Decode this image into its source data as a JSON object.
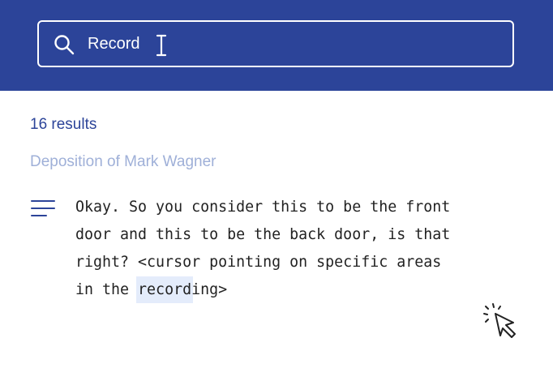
{
  "search": {
    "value": "Record"
  },
  "results": {
    "count_label": "16 results"
  },
  "result": {
    "title": "Deposition of Mark Wagner",
    "snippet": {
      "line1": "Okay. So you consider this to be the front",
      "line2": "door and this to be the back door, is that",
      "line3": "right? <cursor pointing on specific areas",
      "line4_prefix": "in the ",
      "highlight": "record",
      "line4_suffix": "ing>"
    }
  },
  "colors": {
    "header_bg": "#2c4499",
    "results_count": "#2c4499",
    "title": "#9fb0d8",
    "highlight_bg": "#e4ecfb"
  },
  "icons": {
    "search": "search-icon",
    "text_cursor": "text-cursor-icon",
    "snippet": "lines-icon",
    "click_cursor": "click-cursor-icon"
  }
}
